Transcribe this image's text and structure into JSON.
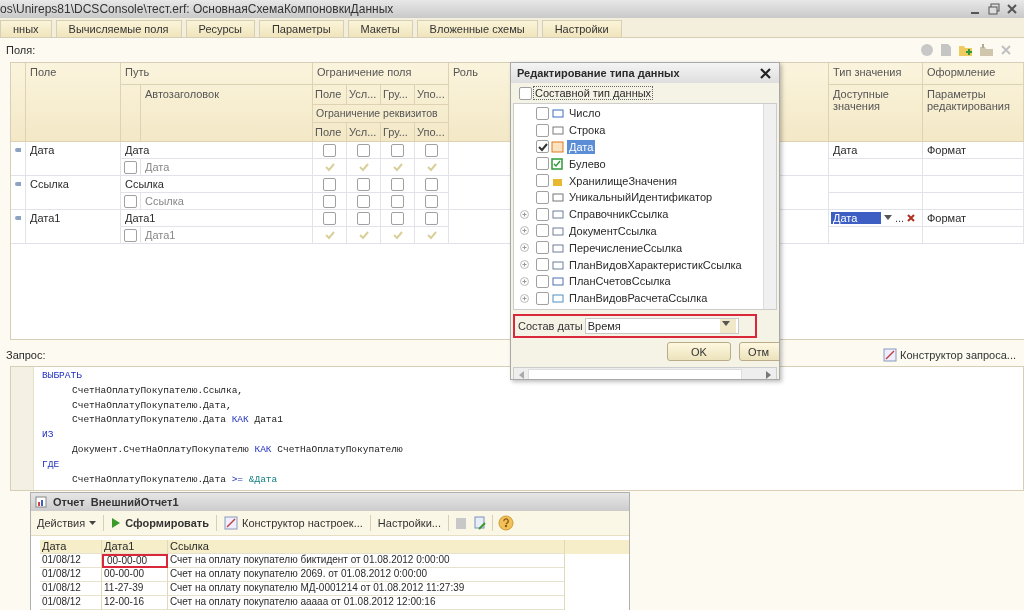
{
  "window": {
    "title": "os\\Unireps81\\DCSConsole\\тест.erf: ОсновнаяСхемаКомпоновкиДанных"
  },
  "tabs": [
    "нных",
    "Вычисляемые поля",
    "Ресурсы",
    "Параметры",
    "Макеты",
    "Вложенные схемы",
    "Настройки"
  ],
  "fields": {
    "label": "Поля:",
    "header": {
      "field": "Поле",
      "path": "Путь",
      "autotitle": "Автозаголовок",
      "field_restriction": "Ограничение поля",
      "field_subcols": [
        "Поле",
        "Усл...",
        "Гру...",
        "Упо..."
      ],
      "attribute_restriction": "Ограничение реквизитов",
      "attribute_subcols": [
        "Поле",
        "Усл...",
        "Гру...",
        "Упо..."
      ],
      "role": "Роль",
      "value_type": "Тип значения",
      "available_values": "Доступные значения",
      "design": "Оформление",
      "edit_params": "Параметры редактирования"
    },
    "rows": [
      {
        "field": "Дата",
        "path": "Дата",
        "autotitle": "Дата",
        "autotitle_checked": false,
        "field_checks": [
          false,
          false,
          false,
          false
        ],
        "attribute_checks": [
          true,
          true,
          true,
          true
        ],
        "value_type": "Дата",
        "design": "Формат",
        "editing": false
      },
      {
        "field": "Ссылка",
        "path": "Ссылка",
        "autotitle": "Ссылка",
        "autotitle_checked": false,
        "field_checks": [
          false,
          false,
          false,
          false
        ],
        "attribute_checks": [
          false,
          false,
          false,
          false
        ],
        "editing": false
      },
      {
        "field": "Дата1",
        "path": "Дата1",
        "autotitle": "Дата1",
        "autotitle_checked": false,
        "field_checks": [
          false,
          false,
          false,
          false
        ],
        "attribute_checks": [
          true,
          true,
          true,
          true
        ],
        "value_type": "Дата",
        "design": "Формат",
        "editing": true,
        "choose_button": "..."
      }
    ]
  },
  "type_dialog": {
    "title": "Редактирование типа данных",
    "composite": {
      "label": "Составной тип данных",
      "checked": false
    },
    "types": [
      {
        "label": "Число",
        "kind": "number",
        "checked": false,
        "selected": false,
        "expandable": false
      },
      {
        "label": "Строка",
        "kind": "string",
        "checked": false,
        "selected": false,
        "expandable": false
      },
      {
        "label": "Дата",
        "kind": "date",
        "checked": true,
        "selected": true,
        "expandable": false
      },
      {
        "label": "Булево",
        "kind": "boolean",
        "checked": false,
        "selected": false,
        "expandable": false
      },
      {
        "label": "ХранилищеЗначения",
        "kind": "storage",
        "checked": false,
        "selected": false,
        "expandable": false
      },
      {
        "label": "УникальныйИдентификатор",
        "kind": "uuid",
        "checked": false,
        "selected": false,
        "expandable": false
      },
      {
        "label": "СправочникСсылка",
        "kind": "reference",
        "checked": false,
        "selected": false,
        "expandable": true
      },
      {
        "label": "ДокументСсылка",
        "kind": "reference",
        "checked": false,
        "selected": false,
        "expandable": true
      },
      {
        "label": "ПеречислениеСсылка",
        "kind": "reference",
        "checked": false,
        "selected": false,
        "expandable": true
      },
      {
        "label": "ПланВидовХарактеристикСсылка",
        "kind": "reference",
        "checked": false,
        "selected": false,
        "expandable": true
      },
      {
        "label": "ПланСчетовСсылка",
        "kind": "accounts",
        "checked": false,
        "selected": false,
        "expandable": true
      },
      {
        "label": "ПланВидовРасчетаСсылка",
        "kind": "calc",
        "checked": false,
        "selected": false,
        "expandable": true
      }
    ],
    "date_composition": {
      "label": "Состав даты",
      "value": "Время",
      "highlighted": true
    },
    "buttons": [
      "OK",
      "Отм"
    ]
  },
  "query": {
    "label": "Запрос:",
    "constructor_button": "Конструктор запроса...",
    "sections": [
      {
        "keyword": "ВЫБРАТЬ",
        "lines": [
          [
            {
              "text": "СчетНаОплатуПокупателю.Ссылка,",
              "kind": "plain"
            }
          ],
          [
            {
              "text": "СчетНаОплатуПокупателю.Дата,",
              "kind": "plain"
            }
          ],
          [
            {
              "text": "СчетНаОплатуПокупателю.Дата ",
              "kind": "plain"
            },
            {
              "text": "КАК",
              "kind": "keyword"
            },
            {
              "text": " Дата1",
              "kind": "plain"
            }
          ]
        ]
      },
      {
        "keyword": "ИЗ",
        "lines": [
          [
            {
              "text": "Документ.СчетНаОплатуПокупателю ",
              "kind": "plain"
            },
            {
              "text": "КАК",
              "kind": "keyword"
            },
            {
              "text": " СчетНаОплатуПокупателю",
              "kind": "plain"
            }
          ]
        ]
      },
      {
        "keyword": "ГДЕ",
        "lines": [
          [
            {
              "text": "СчетНаОплатуПокупателю.Дата ",
              "kind": "plain"
            },
            {
              "text": ">=",
              "kind": "keyword"
            },
            {
              "text": " &Дата",
              "kind": "param"
            }
          ]
        ]
      }
    ]
  },
  "report": {
    "title": "Отчет",
    "name": "ВнешнийОтчет1",
    "actions": "Действия",
    "generate": "Сформировать",
    "constructor": "Конструктор настроек...",
    "settings": "Настройки...",
    "columns": [
      "Дата",
      "Дата1",
      "Ссылка"
    ],
    "rows": [
      {
        "cells": [
          "01/08/12",
          "00-00-00",
          "Счет на оплату покупателю биктидент от 01.08.2012 0:00:00"
        ],
        "marked": true
      },
      {
        "cells": [
          "01/08/12",
          "00-00-00",
          "Счет на оплату покупателю 2069. от 01.08.2012 0:00:00"
        ],
        "marked": false
      },
      {
        "cells": [
          "01/08/12",
          "11-27-39",
          "Счет на оплату покупателю МД-0001214 от 01.08.2012 11:27:39"
        ],
        "marked": false
      },
      {
        "cells": [
          "01/08/12",
          "12-00-16",
          "Счет на оплату покупателю ааааа от 01.08.2012 12:00:16"
        ],
        "marked": false
      }
    ]
  }
}
